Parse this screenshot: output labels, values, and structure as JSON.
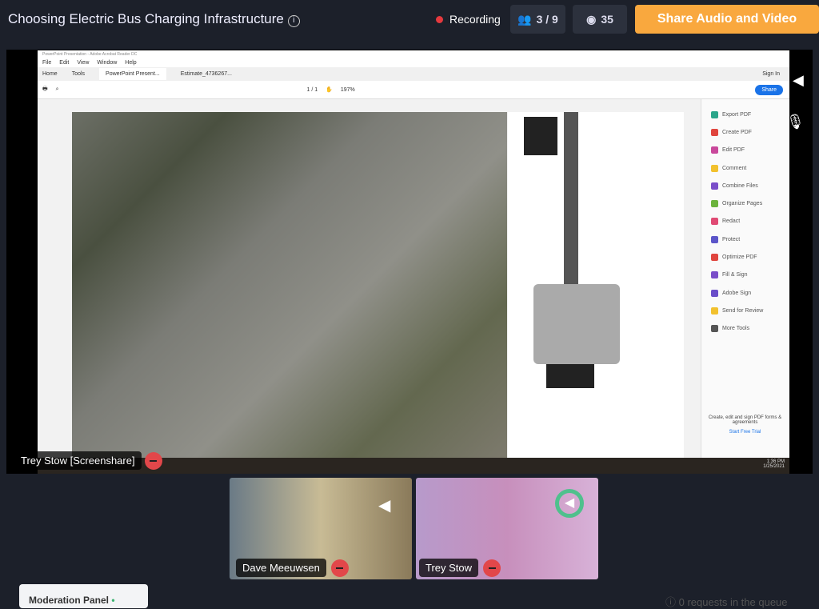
{
  "header": {
    "title": "Choosing Electric Bus Charging Infrastructure",
    "recording": "Recording",
    "participants": "3 / 9",
    "viewers": "35",
    "share_button": "Share Audio and Video"
  },
  "acrobat": {
    "window_title": "PowerPoint Presentation - Adobe Acrobat Reader DC",
    "menu": [
      "File",
      "Edit",
      "View",
      "Window",
      "Help"
    ],
    "tabs": [
      "Home",
      "Tools",
      "PowerPoint Present...",
      "Estimate_4736267..."
    ],
    "sign_in": "Sign In",
    "share": "Share",
    "page": "1 / 1",
    "zoom": "197%",
    "tools": [
      {
        "label": "Export PDF",
        "color": "#2aa58a"
      },
      {
        "label": "Create PDF",
        "color": "#e0453e"
      },
      {
        "label": "Edit PDF",
        "color": "#c9489b"
      },
      {
        "label": "Comment",
        "color": "#f2c12e"
      },
      {
        "label": "Combine Files",
        "color": "#7a4ec9"
      },
      {
        "label": "Organize Pages",
        "color": "#6bb33c"
      },
      {
        "label": "Redact",
        "color": "#e04a74"
      },
      {
        "label": "Protect",
        "color": "#5b55c9"
      },
      {
        "label": "Optimize PDF",
        "color": "#e0453e"
      },
      {
        "label": "Fill & Sign",
        "color": "#7a4ec9"
      },
      {
        "label": "Adobe Sign",
        "color": "#6a4ec9"
      },
      {
        "label": "Send for Review",
        "color": "#f2c12e"
      },
      {
        "label": "More Tools",
        "color": "#555555"
      }
    ],
    "promo": "Create, edit and sign PDF forms & agreements",
    "trial": "Start Free Trial",
    "time": "1:36 PM",
    "date": "1/25/2021"
  },
  "screenshare_label": "Trey Stow [Screenshare]",
  "participants": [
    {
      "name": "Dave Meeuwsen"
    },
    {
      "name": "Trey Stow"
    }
  ],
  "footer": {
    "moderation": "Moderation Panel",
    "queue": "0 requests in the queue"
  }
}
